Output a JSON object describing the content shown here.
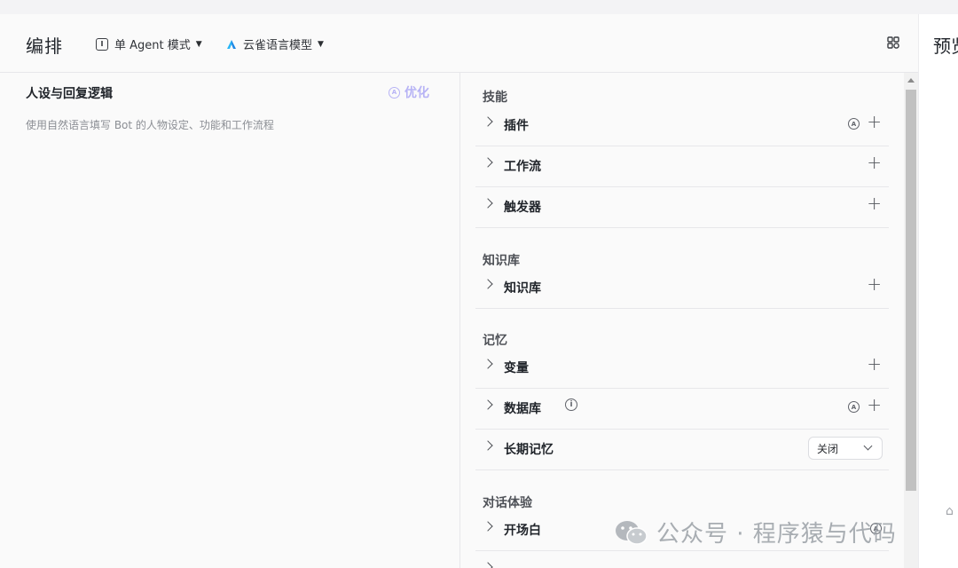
{
  "header": {
    "title": "编排",
    "mode_label": "单 Agent 模式",
    "model_label": "云雀语言模型"
  },
  "persona": {
    "title": "人设与回复逻辑",
    "optimize_label": "优化",
    "placeholder": "使用自然语言填写 Bot 的人物设定、功能和工作流程"
  },
  "groups": {
    "skills": {
      "title": "技能",
      "items": [
        {
          "label": "插件"
        },
        {
          "label": "工作流"
        },
        {
          "label": "触发器"
        }
      ]
    },
    "knowledge": {
      "title": "知识库",
      "items": [
        {
          "label": "知识库"
        }
      ]
    },
    "memory": {
      "title": "记忆",
      "items": [
        {
          "label": "变量"
        },
        {
          "label": "数据库"
        },
        {
          "label": "长期记忆",
          "dropdown_value": "关闭"
        }
      ]
    },
    "dialog": {
      "title": "对话体验",
      "items": [
        {
          "label": "开场白"
        }
      ]
    }
  },
  "preview": {
    "title": "预览"
  },
  "watermark": {
    "text": "公众号 · 程序猿与代码"
  },
  "icons": {
    "agent": "agent-mode-icon",
    "model": "skylark-model-icon",
    "grid": "grid-icon",
    "auto": "auto-icon",
    "info": "info-icon",
    "plus": "plus-icon",
    "chevron": "chevron-right-icon"
  },
  "colors": {
    "optimize_accent": "#b7b3f5",
    "model_icon_blue": "#1e88e5",
    "background": "#fafafa"
  }
}
